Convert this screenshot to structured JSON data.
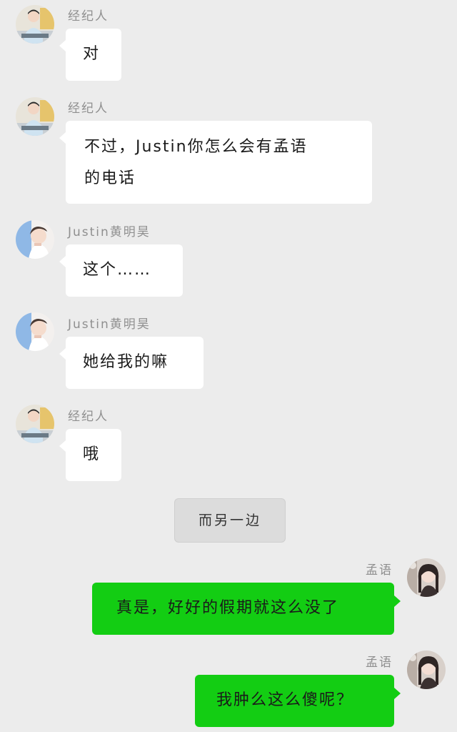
{
  "participants": {
    "agent": {
      "name": "经纪人",
      "avatar_icon": "agent-avatar-icon"
    },
    "justin": {
      "name": "Justin黄明昊",
      "avatar_icon": "justin-avatar-icon"
    },
    "mengyu": {
      "name": "孟语",
      "avatar_icon": "mengyu-avatar-icon"
    }
  },
  "messages": [
    {
      "sender": "经纪人",
      "text": "对"
    },
    {
      "sender": "经纪人",
      "text_line1": "不过，Justin你怎么会有孟语",
      "text_line2": "的电话"
    },
    {
      "sender": "Justin黄明昊",
      "text": "这个……"
    },
    {
      "sender": "Justin黄明昊",
      "text": "她给我的嘛"
    },
    {
      "sender": "经纪人",
      "text": "哦"
    },
    {
      "sender": "孟语",
      "text": "真是，好好的假期就这么没了"
    },
    {
      "sender": "孟语",
      "text": "我肿么这么傻呢？"
    }
  ],
  "scene_divider": {
    "text": "而另一边"
  },
  "colors": {
    "background": "#ececec",
    "incoming_bubble": "#ffffff",
    "outgoing_bubble": "#13cd13",
    "name_text": "#8f8f8f",
    "divider_bg": "#dcdcdc"
  }
}
